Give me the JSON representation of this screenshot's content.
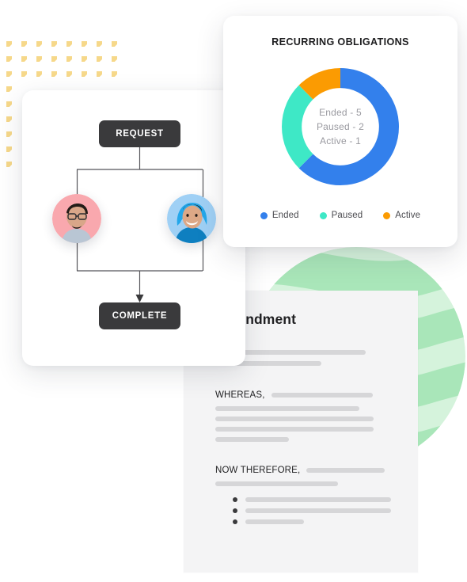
{
  "chart_card": {
    "title": "RECURRING OBLIGATIONS",
    "center_lines": [
      "Ended - 5",
      "Paused - 2",
      "Active - 1"
    ],
    "legend": [
      {
        "label": "Ended",
        "color": "#3380ec"
      },
      {
        "label": "Paused",
        "color": "#3ee8c6"
      },
      {
        "label": "Active",
        "color": "#fb9b02"
      }
    ]
  },
  "chart_data": {
    "type": "pie",
    "title": "RECURRING OBLIGATIONS",
    "categories": [
      "Ended",
      "Paused",
      "Active"
    ],
    "values": [
      5,
      2,
      1
    ],
    "colors": [
      "#3380ec",
      "#3ee8c6",
      "#fb9b02"
    ],
    "total": 8,
    "percentages": [
      62.5,
      25.0,
      12.5
    ],
    "donut": true,
    "inner_radius_ratio": 0.66,
    "start_angle_deg": 0,
    "direction": "clockwise",
    "legend_position": "bottom",
    "center_text": [
      "Ended - 5",
      "Paused - 2",
      "Active - 1"
    ],
    "xlabel": "",
    "ylabel": ""
  },
  "flow_card": {
    "start_label": "REQUEST",
    "end_label": "COMPLETE",
    "approvers": [
      {
        "name": "approver-1",
        "bg": "#f9a8ae"
      },
      {
        "name": "approver-2",
        "bg": "#9fd0f5"
      }
    ]
  },
  "document": {
    "title": "Amendment",
    "clause_1_label": "WHEREAS,",
    "clause_2_label": "NOW THEREFORE,"
  },
  "decor": {
    "dot_color": "#f6d88a",
    "dot_rows": 9,
    "dot_cols": 8,
    "blob_color_light": "#d9f5de",
    "blob_color_dark": "#a9e6b9"
  }
}
